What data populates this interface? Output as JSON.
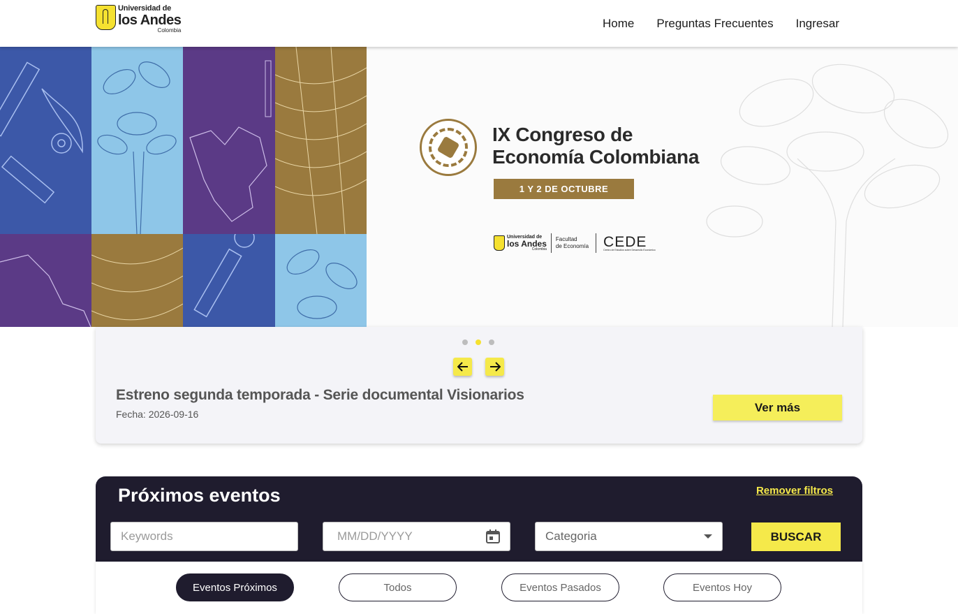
{
  "header": {
    "logo": {
      "line1": "Universidad de",
      "line2": "los Andes",
      "line3": "Colombia"
    },
    "nav": [
      "Home",
      "Preguntas Frecuentes",
      "Ingresar"
    ]
  },
  "banner": {
    "title_line1": "IX Congreso de",
    "title_line2": "Economía Colombiana",
    "date": "1 Y 2 DE OCTUBRE",
    "partners": {
      "uni_line1": "Universidad de",
      "uni_line2": "los Andes",
      "uni_line3": "Colombia",
      "faculty_line1": "Facultad",
      "faculty_line2": "de Economía",
      "cede": "CEDE",
      "cede_sub": "Centro de Estudios sobre Desarrollo Económico"
    },
    "colors": {
      "blue": "#3c58a8",
      "light_blue": "#8ec6e8",
      "purple": "#5b3a86",
      "gold": "#9a7a3e"
    }
  },
  "carousel": {
    "active_slide": 2,
    "slide_count": 3,
    "event_title": "Estreno segunda temporada - Serie documental Visionarios",
    "event_date": "Fecha: 2026-09-16",
    "cta": "Ver más",
    "prev_icon": "arrow-left-icon",
    "next_icon": "arrow-right-icon"
  },
  "events": {
    "title": "Próximos eventos",
    "remove_filters": "Remover filtros",
    "keywords_placeholder": "Keywords",
    "date_placeholder": "MM/DD/YYYY",
    "category_placeholder": "Categoria",
    "search_button": "BUSCAR",
    "tabs": [
      "Eventos Próximos",
      "Todos",
      "Eventos Pasados",
      "Eventos Hoy"
    ],
    "active_tab": 0
  },
  "colors": {
    "accent": "#f5e94a",
    "dark": "#1f1c2e"
  }
}
